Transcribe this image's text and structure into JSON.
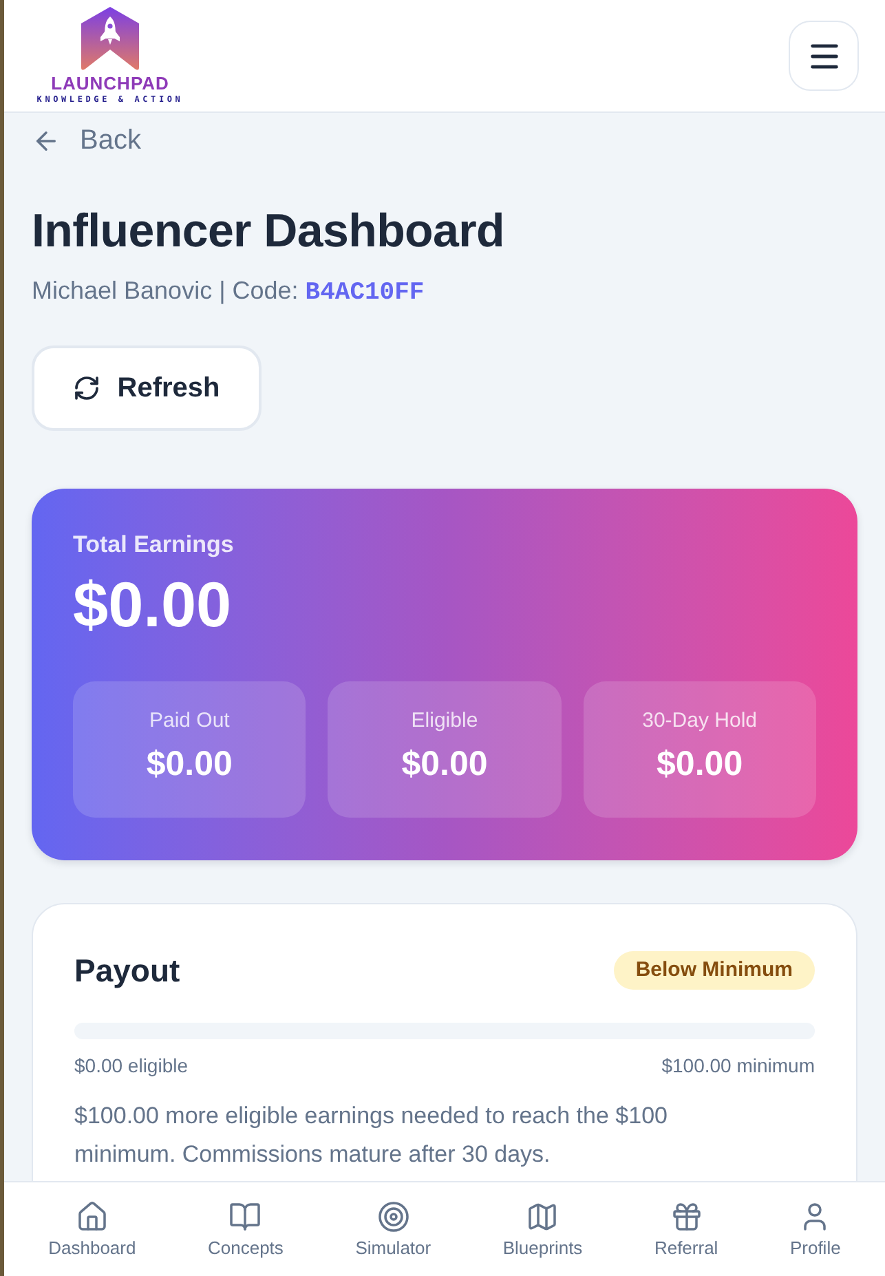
{
  "header": {
    "logo_title": "LAUNCHPAD",
    "logo_tagline": "KNOWLEDGE & ACTION"
  },
  "back_link": {
    "label": "Back"
  },
  "page": {
    "title": "Influencer Dashboard",
    "subtitle": "Michael Banovic | Code:",
    "code": "B4AC10FF"
  },
  "refresh_button": {
    "label": "Refresh"
  },
  "earnings": {
    "label": "Total Earnings",
    "amount": "$0.00",
    "breakdown": [
      {
        "label": "Paid Out",
        "amount": "$0.00"
      },
      {
        "label": "Eligible",
        "amount": "$0.00"
      },
      {
        "label": "30-Day Hold",
        "amount": "$0.00"
      }
    ]
  },
  "payout": {
    "title": "Payout",
    "status": "Below Minimum",
    "level": 0,
    "eligible_label": "$0.00 eligible",
    "minimum_label": "$100.00 minimum",
    "note": "$100.00 more eligible earnings needed to reach the $100 minimum. Commissions mature after 30 days."
  },
  "nav": [
    {
      "label": "Dashboard",
      "selected": false
    },
    {
      "label": "Concepts",
      "selected": false
    },
    {
      "label": "Simulator",
      "selected": false
    },
    {
      "label": "Blueprints",
      "selected": false
    },
    {
      "label": "Referral",
      "selected": false
    },
    {
      "label": "Profile",
      "selected": false
    }
  ]
}
